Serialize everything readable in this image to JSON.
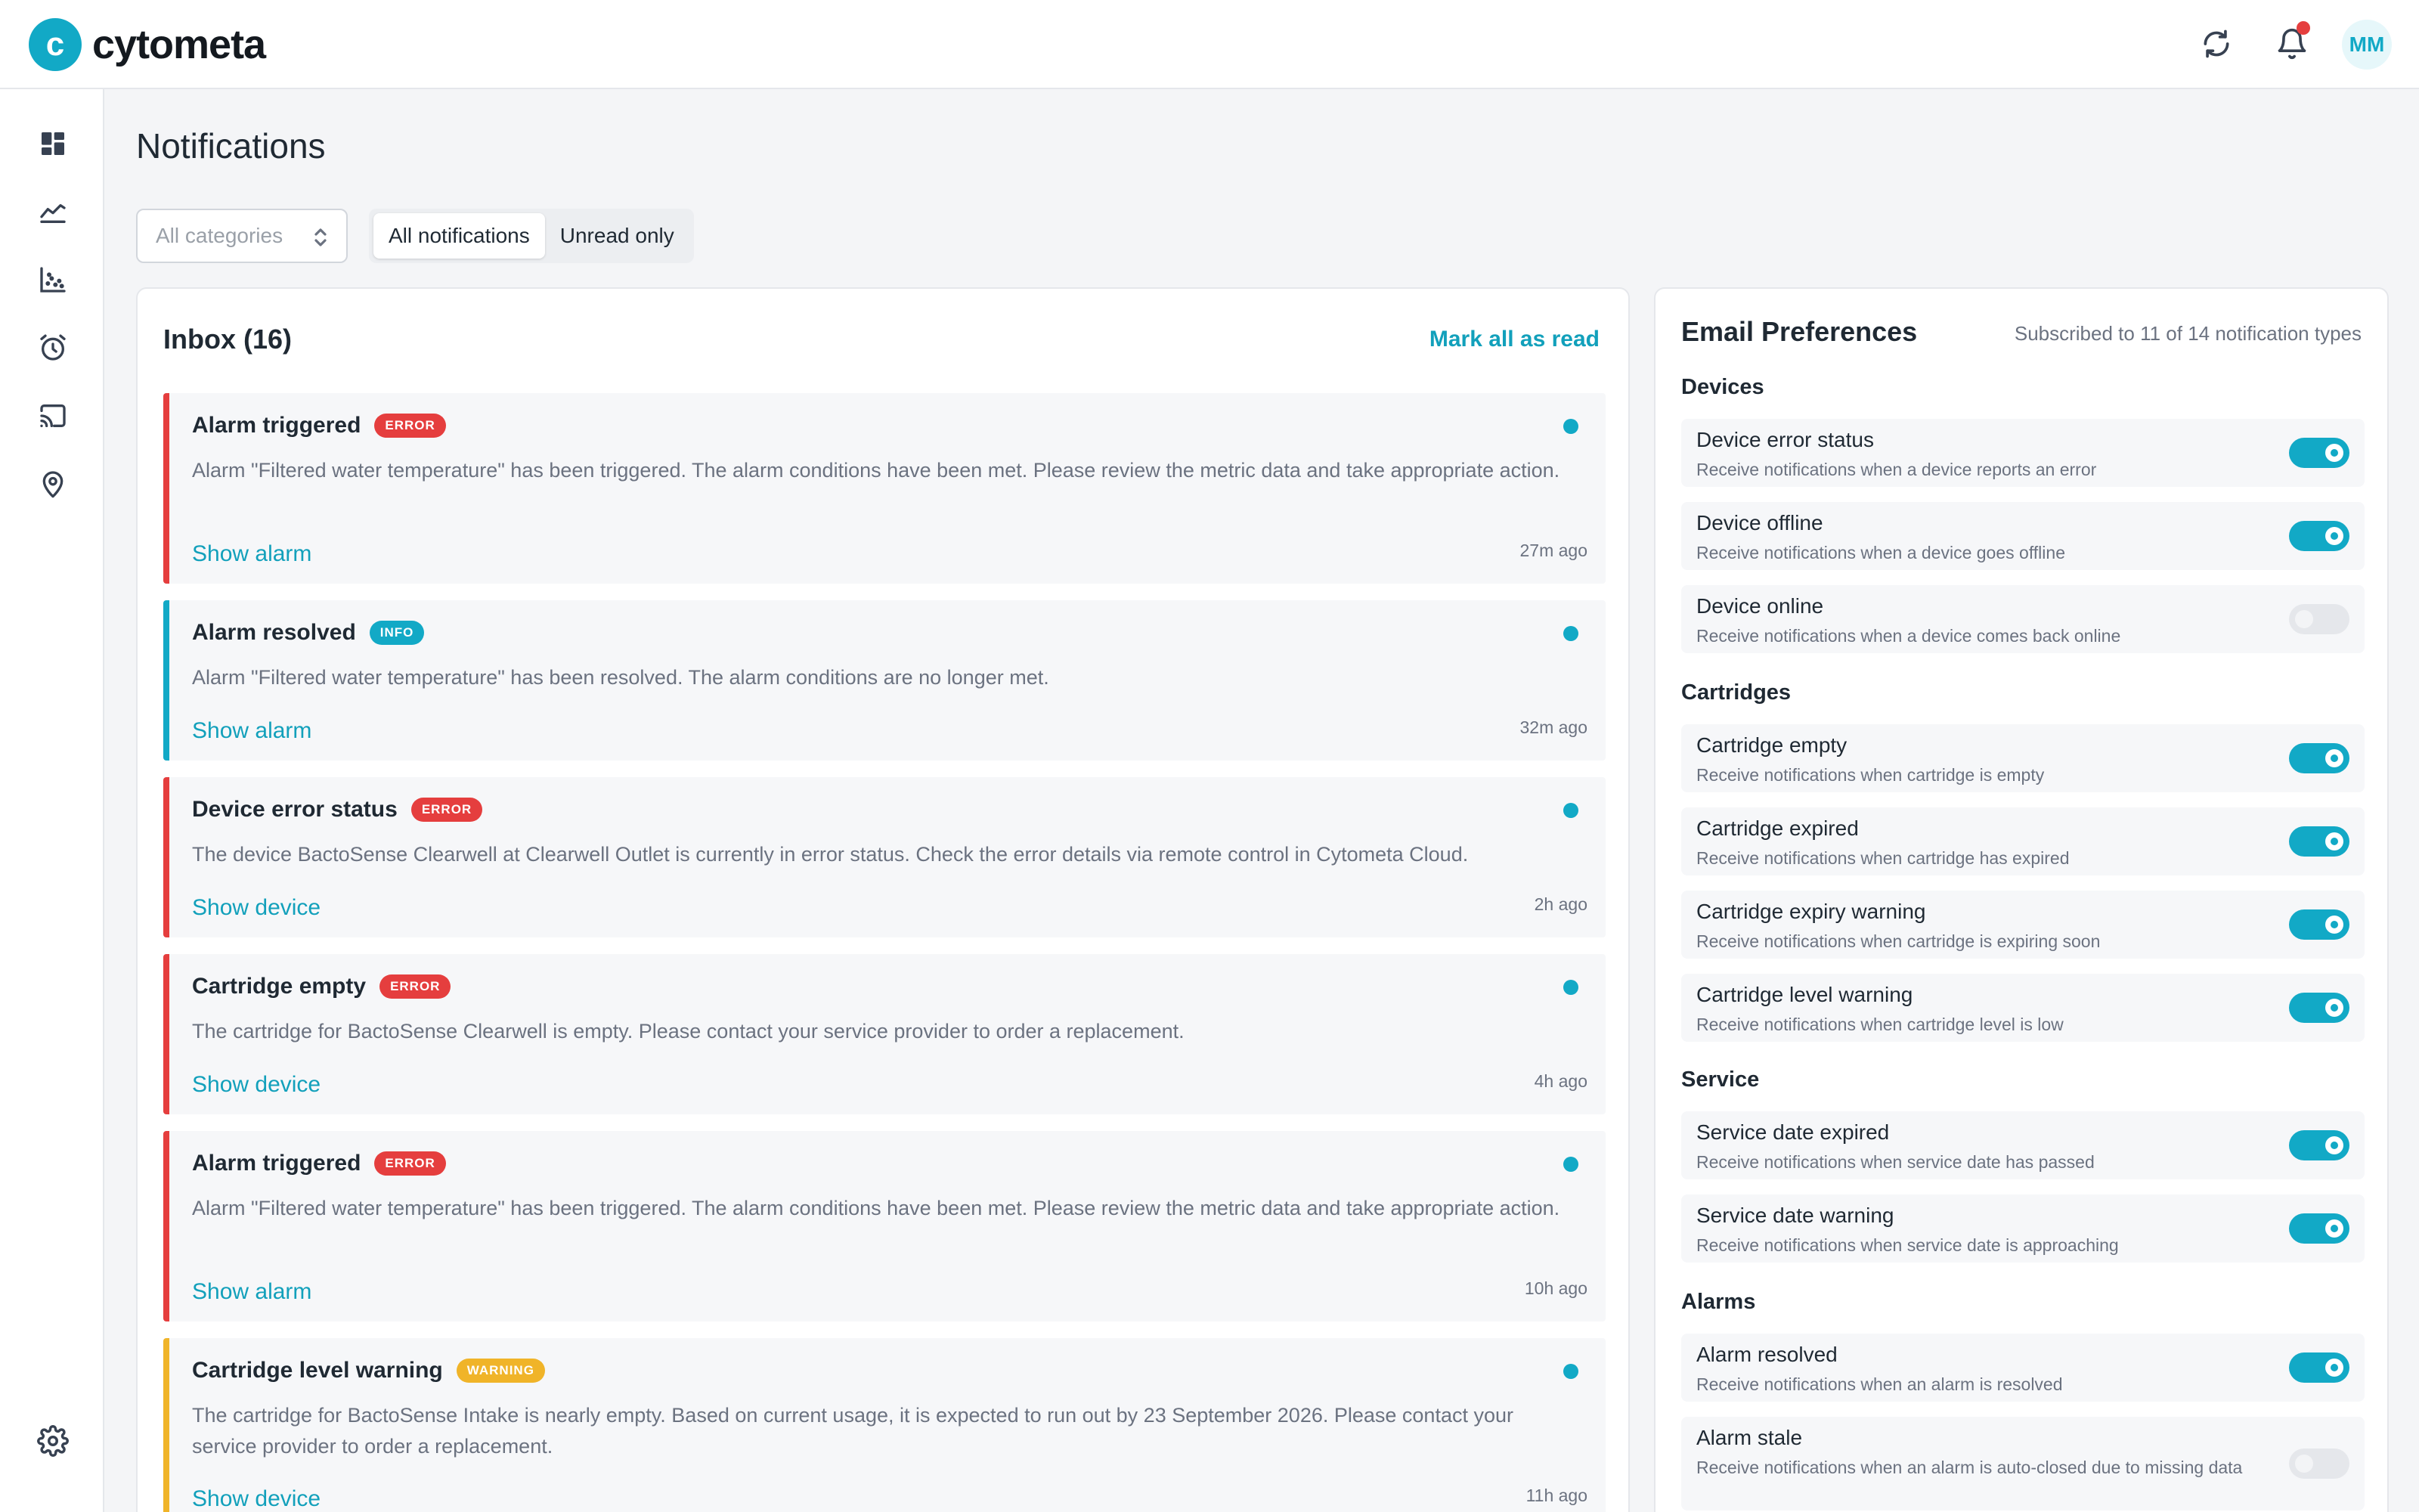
{
  "app": {
    "logo_letter": "c",
    "name": "cytometa",
    "user_initials": "MM"
  },
  "page": {
    "title": "Notifications"
  },
  "filters": {
    "category_placeholder": "All categories",
    "tabs": [
      {
        "label": "All notifications",
        "active": true
      },
      {
        "label": "Unread only",
        "active": false
      }
    ]
  },
  "inbox": {
    "title": "Inbox (16)",
    "mark_all": "Mark all as read",
    "items": [
      {
        "title": "Alarm triggered",
        "badge": "ERROR",
        "severity": "error",
        "body": "Alarm \"Filtered water temperature\" has been triggered. The alarm conditions have been met. Please review the metric data and take appropriate action.",
        "link": "Show alarm",
        "time": "27m ago",
        "unread": true
      },
      {
        "title": "Alarm resolved",
        "badge": "INFO",
        "severity": "info",
        "body": "Alarm \"Filtered water temperature\" has been resolved. The alarm conditions are no longer met.",
        "link": "Show alarm",
        "time": "32m ago",
        "unread": true
      },
      {
        "title": "Device error status",
        "badge": "ERROR",
        "severity": "error",
        "body": "The device BactoSense Clearwell at Clearwell Outlet is currently in error status. Check the error details via remote control in Cytometa Cloud.",
        "link": "Show device",
        "time": "2h ago",
        "unread": true
      },
      {
        "title": "Cartridge empty",
        "badge": "ERROR",
        "severity": "error",
        "body": "The cartridge for BactoSense Clearwell is empty. Please contact your service provider to order a replacement.",
        "link": "Show device",
        "time": "4h ago",
        "unread": true
      },
      {
        "title": "Alarm triggered",
        "badge": "ERROR",
        "severity": "error",
        "body": "Alarm \"Filtered water temperature\" has been triggered. The alarm conditions have been met. Please review the metric data and take appropriate action.",
        "link": "Show alarm",
        "time": "10h ago",
        "unread": true
      },
      {
        "title": "Cartridge level warning",
        "badge": "WARNING",
        "severity": "warning",
        "body": "The cartridge for BactoSense Intake is nearly empty. Based on current usage, it is expected to run out by 23 September 2026. Please contact your service provider to order a replacement.",
        "link": "Show device",
        "time": "11h ago",
        "unread": true
      }
    ]
  },
  "prefs": {
    "title": "Email Preferences",
    "subtitle": "Subscribed to 11 of 14 notification types",
    "groups": {
      "devices": "Devices",
      "cartridges": "Cartridges",
      "service": "Service",
      "alarms": "Alarms"
    },
    "items": [
      {
        "title": "Device error status",
        "desc": "Receive notifications when a device reports an error",
        "enabled": true
      },
      {
        "title": "Device offline",
        "desc": "Receive notifications when a device goes offline",
        "enabled": true
      },
      {
        "title": "Device online",
        "desc": "Receive notifications when a device comes back online",
        "enabled": false
      },
      {
        "title": "Cartridge empty",
        "desc": "Receive notifications when cartridge is empty",
        "enabled": true
      },
      {
        "title": "Cartridge expired",
        "desc": "Receive notifications when cartridge has expired",
        "enabled": true
      },
      {
        "title": "Cartridge expiry warning",
        "desc": "Receive notifications when cartridge is expiring soon",
        "enabled": true
      },
      {
        "title": "Cartridge level warning",
        "desc": "Receive notifications when cartridge level is low",
        "enabled": true
      },
      {
        "title": "Service date expired",
        "desc": "Receive notifications when service date has passed",
        "enabled": true
      },
      {
        "title": "Service date warning",
        "desc": "Receive notifications when service date is approaching",
        "enabled": true
      },
      {
        "title": "Alarm resolved",
        "desc": "Receive notifications when an alarm is resolved",
        "enabled": true
      },
      {
        "title": "Alarm stale",
        "desc": "Receive notifications when an alarm is auto-closed due to missing data",
        "enabled": false
      }
    ]
  },
  "icons": {
    "sidebar": [
      "dashboard-icon",
      "trend-chart-icon",
      "scatter-chart-icon",
      "alarm-clock-icon",
      "cast-icon",
      "location-pin-icon",
      "settings-gear-icon"
    ],
    "topbar": [
      "refresh-icon",
      "bell-icon"
    ]
  },
  "colors": {
    "accent": "#12a9c6",
    "error": "#e53e3e",
    "warning": "#f0b429"
  }
}
